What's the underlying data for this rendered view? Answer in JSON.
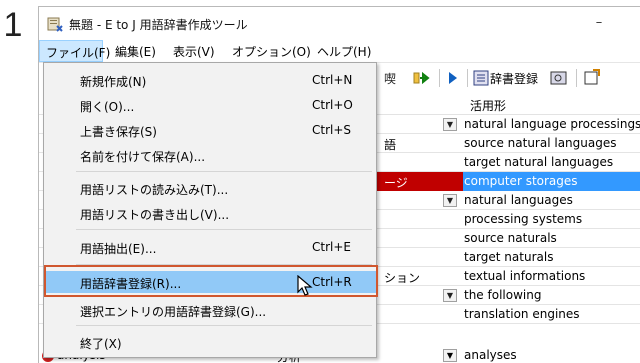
{
  "step_number": "1",
  "window": {
    "title": "無題 - E to J 用語辞書作成ツール",
    "minimize_glyph": "–"
  },
  "menubar": {
    "items": [
      {
        "label": "ファイル(F)"
      },
      {
        "label": "編集(E)"
      },
      {
        "label": "表示(V)"
      },
      {
        "label": "オプション(O)"
      },
      {
        "label": "ヘルプ(H)"
      }
    ]
  },
  "toolbar": {
    "register_label": "辞書登録"
  },
  "grid": {
    "column_header": "活用形",
    "rows": [
      {
        "mid": "",
        "dropdown": true,
        "inflection": "natural language processings"
      },
      {
        "mid": "語",
        "dropdown": false,
        "inflection": "source natural languages"
      },
      {
        "mid": "",
        "dropdown": false,
        "inflection": "target natural languages"
      },
      {
        "mid": "ージ",
        "dropdown": false,
        "inflection": "computer storages",
        "selected": true
      },
      {
        "mid": "",
        "dropdown": true,
        "inflection": "natural languages"
      },
      {
        "mid": "",
        "dropdown": false,
        "inflection": "processing systems"
      },
      {
        "mid": "",
        "dropdown": false,
        "inflection": "source naturals"
      },
      {
        "mid": "",
        "dropdown": false,
        "inflection": "target naturals"
      },
      {
        "mid": "ション",
        "dropdown": false,
        "inflection": "textual informations"
      },
      {
        "mid": "",
        "dropdown": true,
        "inflection": "the following"
      },
      {
        "mid": "",
        "dropdown": false,
        "inflection": "translation engines"
      }
    ],
    "bottom_row": {
      "icon_letter": "S",
      "term": "analysis",
      "translation": "分析",
      "inflection": "analyses"
    }
  },
  "file_menu": {
    "items": [
      {
        "label": "新規作成(N)",
        "shortcut": "Ctrl+N"
      },
      {
        "label": "開く(O)...",
        "shortcut": "Ctrl+O"
      },
      {
        "label": "上書き保存(S)",
        "shortcut": "Ctrl+S"
      },
      {
        "label": "名前を付けて保存(A)...",
        "shortcut": ""
      },
      {
        "label": "用語リストの読み込み(T)...",
        "shortcut": ""
      },
      {
        "label": "用語リストの書き出し(V)...",
        "shortcut": ""
      },
      {
        "label": "用語抽出(E)...",
        "shortcut": "Ctrl+E"
      },
      {
        "label": "用語辞書登録(R)...",
        "shortcut": "Ctrl+R",
        "highlighted": true
      },
      {
        "label": "選択エントリの用語辞書登録(G)...",
        "shortcut": ""
      },
      {
        "label": "終了(X)",
        "shortcut": ""
      }
    ]
  },
  "colors": {
    "menu_highlight": "#91c9f7",
    "selection_blue": "#3399ff",
    "selection_red": "#c00000",
    "callout_border": "#d0572f"
  }
}
